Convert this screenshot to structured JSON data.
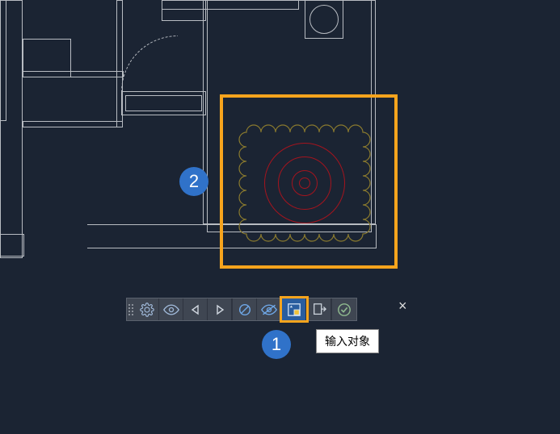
{
  "callouts": {
    "step1": "1",
    "step2": "2"
  },
  "toolbar": {
    "tooltip_input_object": "输入对象",
    "buttons": {
      "settings": "settings",
      "visibility": "visibility",
      "prev": "prev",
      "next": "next",
      "disable_view": "disable-view",
      "eye_off": "eye-off",
      "import_object": "import-object",
      "export": "export",
      "confirm": "confirm"
    }
  },
  "close_label": "×",
  "colors": {
    "highlight": "#f7a41d",
    "callout": "#3072c9",
    "target_circle": "#a5141e",
    "rug_border": "#8a7a2e",
    "drawing_line": "#b8bcc2",
    "canvas_bg": "#1b2433",
    "toolbar_bg": "#3f4652"
  }
}
